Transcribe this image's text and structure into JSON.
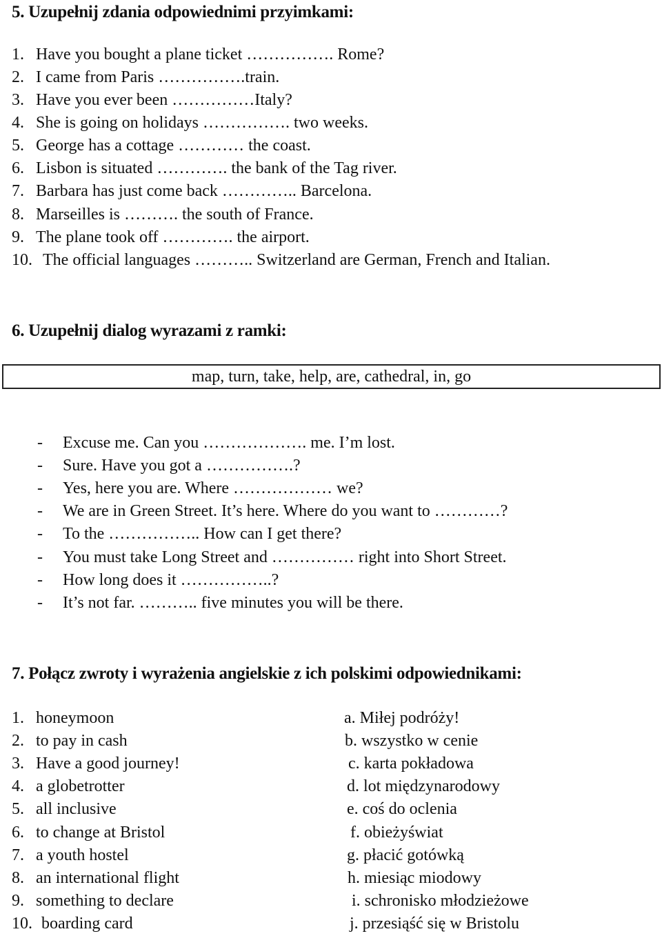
{
  "section5": {
    "heading": "5. Uzupełnij zdania odpowiednimi przyimkami:",
    "items": [
      {
        "num": "1.",
        "text": "Have you bought a plane ticket ……………. Rome?"
      },
      {
        "num": "2.",
        "text": "I came from Paris …………….train."
      },
      {
        "num": "3.",
        "text": "Have you ever been ……………Italy?"
      },
      {
        "num": "4.",
        "text": "She is going on holidays ……………. two weeks."
      },
      {
        "num": "5.",
        "text": "George has a cottage ………… the coast."
      },
      {
        "num": "6.",
        "text": "Lisbon is situated …………. the bank of the Tag river."
      },
      {
        "num": "7.",
        "text": "Barbara has just come back ………….. Barcelona."
      },
      {
        "num": "8.",
        "text": "Marseilles is ………. the south of France."
      },
      {
        "num": "9.",
        "text": "The plane took off …………. the airport."
      },
      {
        "num": "10.",
        "text": "The official languages ……….. Switzerland are German, French and Italian."
      }
    ]
  },
  "section6": {
    "heading": "6. Uzupełnij dialog wyrazami z ramki:",
    "word_box": "map, turn, take, help, are, cathedral, in, go",
    "dialog": [
      {
        "dash": "-",
        "text": "Excuse me. Can you ………………. me. I’m lost."
      },
      {
        "dash": "-",
        "text": "Sure. Have you got a …………….?"
      },
      {
        "dash": "-",
        "text": "Yes, here you are. Where ……………… we?"
      },
      {
        "dash": "-",
        "text": "We are in Green Street. It’s here. Where do you want to …………?"
      },
      {
        "dash": "-",
        "text": "To the ……………..  How can I get there?"
      },
      {
        "dash": "-",
        "text": "You must take Long Street and …………… right into Short Street."
      },
      {
        "dash": "-",
        "text": "How long does it ……………..?"
      },
      {
        "dash": "-",
        "text": "It’s not far. ……….. five minutes you will be there."
      }
    ]
  },
  "section7": {
    "heading": "7.  Połącz zwroty i wyrażenia angielskie z ich polskimi odpowiednikami:",
    "english": [
      {
        "num": "1.",
        "text": "honeymoon"
      },
      {
        "num": "2.",
        "text": "to pay in cash"
      },
      {
        "num": "3.",
        "text": "Have a good journey!"
      },
      {
        "num": "4.",
        "text": "a globetrotter"
      },
      {
        "num": "5.",
        "text": "all inclusive"
      },
      {
        "num": "6.",
        "text": "to change at Bristol"
      },
      {
        "num": "7.",
        "text": "a youth hostel"
      },
      {
        "num": "8.",
        "text": "an international flight"
      },
      {
        "num": "9.",
        "text": "something to declare"
      },
      {
        "num": "10.",
        "text": "boarding card"
      }
    ],
    "polish": [
      "a. Miłej podróży!",
      "b. wszystko w cenie",
      "c. karta pokładowa",
      "d. lot międzynarodowy",
      "e. coś do oclenia",
      "f. obieżyświat",
      "g. płacić gotówką",
      "h. miesiąc miodowy",
      "i. schronisko młodzieżowe",
      "j. przesiąść się w Bristolu"
    ]
  }
}
